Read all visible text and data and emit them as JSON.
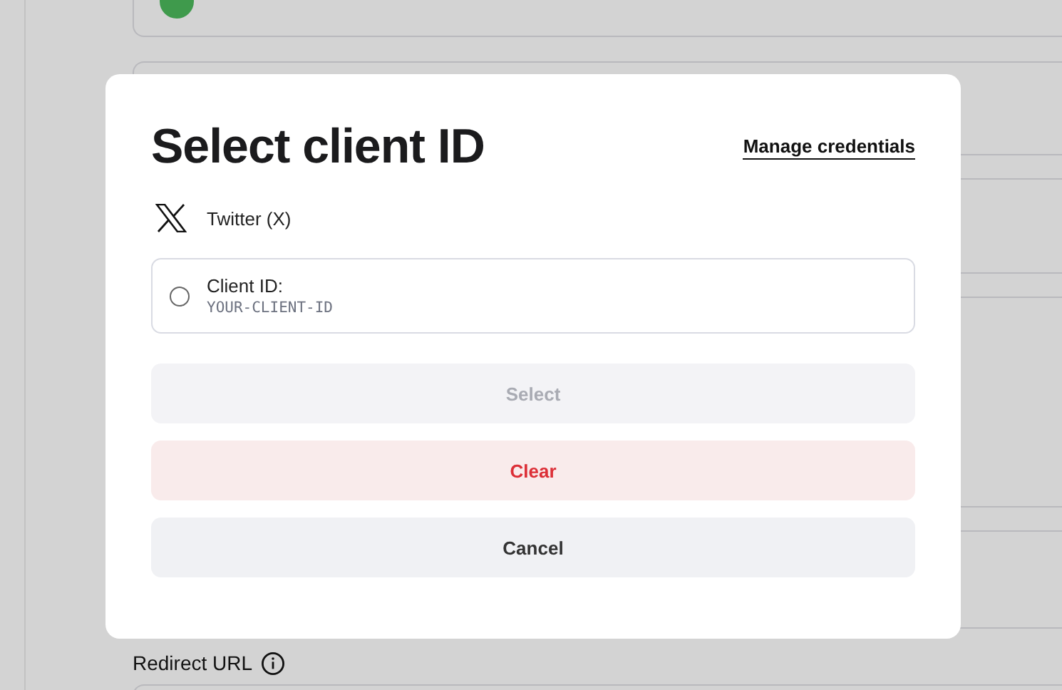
{
  "background": {
    "field_label": "Redirect URL"
  },
  "dialog": {
    "title": "Select client ID",
    "manage_link": "Manage credentials",
    "provider": "Twitter (X)",
    "options": [
      {
        "label": "Client ID:",
        "value": "YOUR-CLIENT-ID",
        "selected": false
      }
    ],
    "buttons": [
      {
        "label": "Select",
        "kind": "primary",
        "disabled": true
      },
      {
        "label": "Clear",
        "kind": "danger",
        "disabled": false
      },
      {
        "label": "Cancel",
        "kind": "neutral",
        "disabled": false
      }
    ]
  }
}
